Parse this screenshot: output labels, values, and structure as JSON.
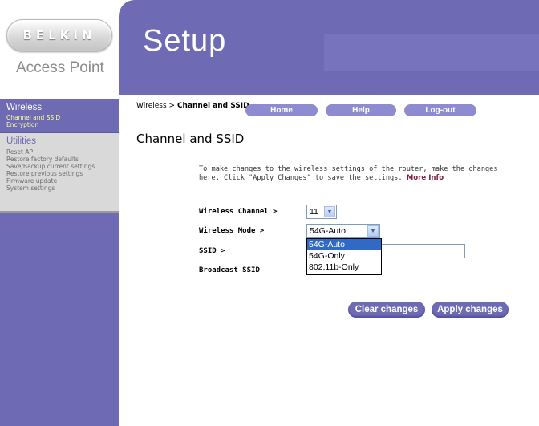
{
  "brand": {
    "logo_text": "BELKIN",
    "product": "Access Point",
    "page_title": "Setup"
  },
  "sidebar": {
    "wireless": {
      "heading": "Wireless",
      "items": [
        "Channel and SSID",
        "Encryption"
      ]
    },
    "utilities": {
      "heading": "Utilities",
      "items": [
        "Reset AP",
        "Restore factory defaults",
        "Save/Backup current settings",
        "Restore previous settings",
        "Firmware update",
        "System settings"
      ]
    }
  },
  "nav": {
    "breadcrumb_section": "Wireless",
    "breadcrumb_sep": " > ",
    "breadcrumb_page": "Channel and SSID",
    "home": "Home",
    "help": "Help",
    "logout": "Log-out"
  },
  "main": {
    "title": "Channel and SSID",
    "intro": "To make changes to the wireless settings of the router, make the changes here. Click \"Apply Changes\" to save the settings.",
    "more_info": "More Info",
    "channel_label": "Wireless Channel >",
    "channel_value": "11",
    "mode_label": "Wireless Mode >",
    "mode_value": "54G-Auto",
    "mode_options": [
      "54G-Auto",
      "54G-Only",
      "802.11b-Only"
    ],
    "ssid_label": "SSID >",
    "ssid_value": "",
    "broadcast_label": "Broadcast SSID",
    "clear_button": "Clear changes",
    "apply_button": "Apply changes"
  },
  "colors": {
    "brand_purple": "#6e6ab4",
    "button_light_purple": "#8f8bd0",
    "active_link": "#ffff9c",
    "selection_blue": "#316ac5"
  }
}
